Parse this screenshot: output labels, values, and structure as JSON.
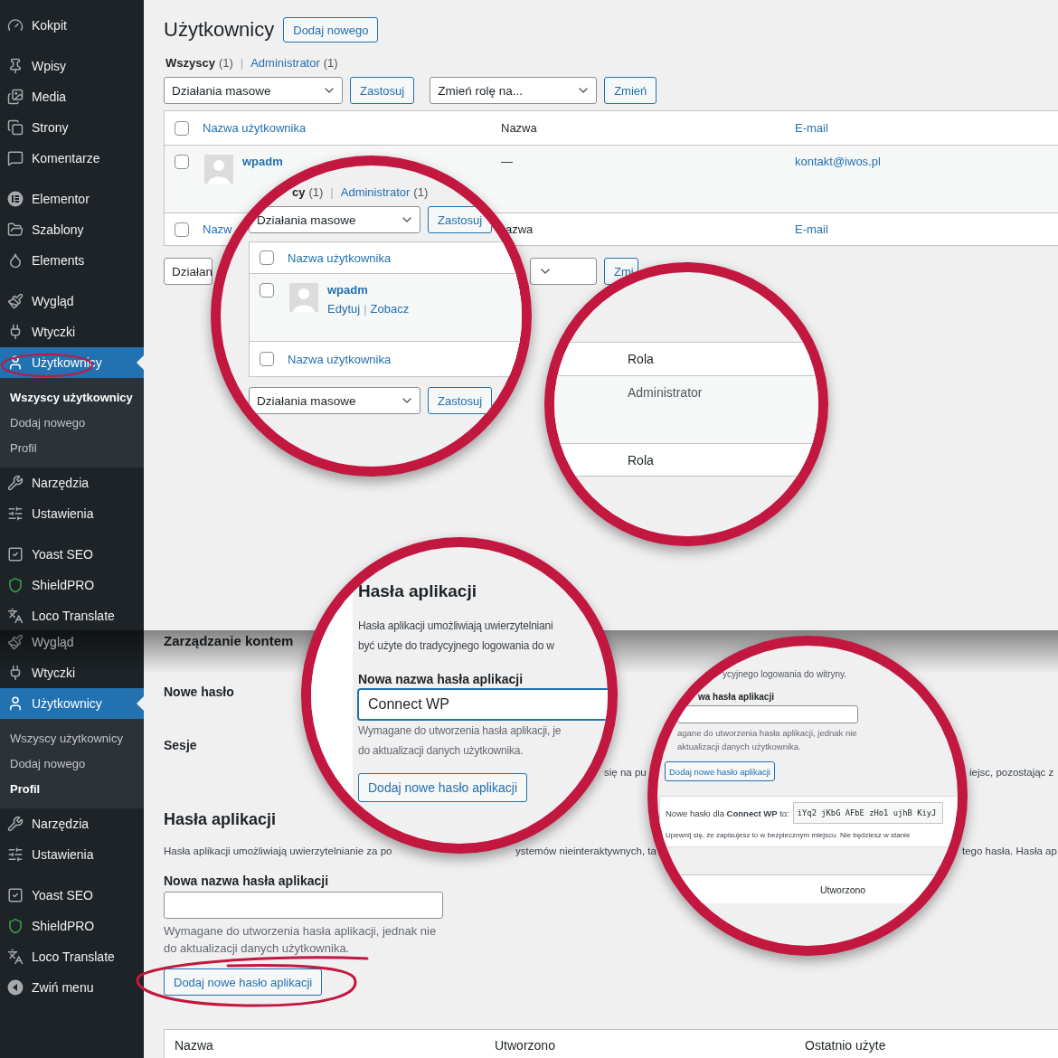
{
  "top": {
    "sidebar": {
      "groups": [
        {
          "items": [
            {
              "label": "Kokpit",
              "selected": false
            }
          ]
        },
        {
          "items": [
            {
              "label": "Wpisy",
              "selected": false
            },
            {
              "label": "Media",
              "selected": false
            },
            {
              "label": "Strony",
              "selected": false
            },
            {
              "label": "Komentarze",
              "selected": false
            }
          ]
        },
        {
          "items": [
            {
              "label": "Elementor",
              "selected": false
            },
            {
              "label": "Szablony",
              "selected": false
            },
            {
              "label": "Elements",
              "selected": false
            }
          ]
        },
        {
          "items": [
            {
              "label": "Wygląd",
              "selected": false
            },
            {
              "label": "Wtyczki",
              "selected": false
            },
            {
              "label": "Użytkownicy",
              "selected": true,
              "children": [
                {
                  "label": "Wszyscy użytkownicy",
                  "selected": true
                },
                {
                  "label": "Dodaj nowego",
                  "selected": false
                },
                {
                  "label": "Profil",
                  "selected": false
                }
              ]
            },
            {
              "label": "Narzędzia",
              "selected": false
            },
            {
              "label": "Ustawienia",
              "selected": false
            }
          ]
        },
        {
          "items": [
            {
              "label": "Yoast SEO",
              "selected": false
            },
            {
              "label": "ShieldPRO",
              "selected": false
            },
            {
              "label": "Loco Translate",
              "selected": false
            }
          ]
        }
      ]
    },
    "page_title": "Użytkownicy",
    "add_button": "Dodaj nowego",
    "filters": [
      {
        "label": "Wszyscy",
        "count": "(1)",
        "selected": true
      },
      {
        "label": "Administrator",
        "count": "(1)",
        "selected": false
      }
    ],
    "filters_separator": "|",
    "bulk_select": "Działania masowe",
    "apply_button": "Zastosuj",
    "role_select": "Zmień rolę na...",
    "change_button": "Zmień",
    "table": {
      "header_checked": false,
      "columns": [
        "Nazwa użytkownika",
        "Nazwa",
        "E-mail"
      ],
      "rows": [
        {
          "checked": false,
          "username": "wpadm",
          "name": "—",
          "email": "kontakt@iwos.pl"
        }
      ],
      "footer_checked": false,
      "footer_columns": [
        "Nazw",
        "azwa",
        "E-mail"
      ]
    },
    "bottom_toolbar": {
      "bulk_select": "Działan",
      "change_button": "Zmi"
    },
    "magnifier_left": {
      "filters": [
        {
          "label": "cy",
          "count": "(1)",
          "selected": true
        },
        {
          "label": "Administrator",
          "count": "(1)",
          "selected": false
        }
      ],
      "filters_separator": "|",
      "bulk_select": "Działania masowe",
      "apply_button": "Zastosuj",
      "header_checked": false,
      "column": "Nazwa użytkownika",
      "row": {
        "checked": false,
        "username": "wpadm",
        "actions": [
          "Edytuj",
          "Zobacz"
        ],
        "actions_separator": "|"
      },
      "footer_checked": false,
      "footer_column": "Nazwa użytkownika",
      "bottom_bulk_select": "Działania masowe",
      "bottom_apply_button": "Zastosuj"
    },
    "magnifier_right": {
      "column": "Rola",
      "cell": "Administrator",
      "footer_column": "Rola"
    }
  },
  "bottom": {
    "sidebar": {
      "groups": [
        {
          "items": [
            {
              "label": "Wygląd",
              "selected": false
            },
            {
              "label": "Wtyczki",
              "selected": false
            },
            {
              "label": "Użytkownicy",
              "selected": true,
              "children": [
                {
                  "label": "Wszyscy użytkownicy",
                  "selected": false
                },
                {
                  "label": "Dodaj nowego",
                  "selected": false
                },
                {
                  "label": "Profil",
                  "selected": true
                }
              ]
            },
            {
              "label": "Narzędzia",
              "selected": false
            },
            {
              "label": "Ustawienia",
              "selected": false
            }
          ]
        },
        {
          "items": [
            {
              "label": "Yoast SEO",
              "selected": false
            },
            {
              "label": "ShieldPRO",
              "selected": false
            },
            {
              "label": "Loco Translate",
              "selected": false
            },
            {
              "label": "Zwiń menu",
              "selected": false
            }
          ]
        }
      ]
    },
    "section_title": "Zarządzanie kontem",
    "fields": [
      "Nowe hasło",
      "Sesje"
    ],
    "sessions_fragments": [
      "się na pu",
      "iejsc, pozostając z"
    ],
    "app_passwords": {
      "title": "Hasła aplikacji",
      "description_fragments": [
        "Hasła aplikacji umożliwiają uwierzytelnianie za po",
        "ystemów nieinteraktywnych, ta",
        "tego hasła. Hasła ap"
      ],
      "name_label": "Nowa nazwa hasła aplikacji",
      "help": "Wymagane do utworzenia hasła aplikacji, jednak nie do aktualizacji danych użytkownika.",
      "add_button": "Dodaj nowe hasło aplikacji",
      "table_columns": [
        "Nazwa",
        "Utworzono",
        "Ostatnio użyte"
      ]
    },
    "magnifier_left": {
      "title": "Hasła aplikacji",
      "description_lines": [
        "Hasła aplikacji umożliwiają uwierzytelniani",
        "być użyte do tradycyjnego logowania do w"
      ],
      "name_label": "Nowa nazwa hasła aplikacji",
      "name_value": "Connect WP",
      "help_lines": [
        "Wymagane do utworzenia hasła aplikacji, je",
        "do aktualizacji danych użytkownika."
      ],
      "add_button": "Dodaj nowe hasło aplikacji"
    },
    "magnifier_right": {
      "description_fragment": "ycyjnego logowania do witryny.",
      "name_label_fragment": "wa hasła aplikacji",
      "help_lines": [
        "agane do utworzenia hasła aplikacji, jednak nie",
        "aktualizacji danych użytkownika."
      ],
      "add_button": "Dodaj nowe hasło aplikacji",
      "notice": {
        "text": "Nowe hasło dla **Connect WP** to:",
        "password": "iYq2 jKbG AFbE zHo1 ujhB KiyJ",
        "warning": "Upewnij się, że zapisujesz to w bezpiecznym miejscu. Nie będziesz w stanie"
      },
      "table_column": "Utworzono"
    }
  }
}
